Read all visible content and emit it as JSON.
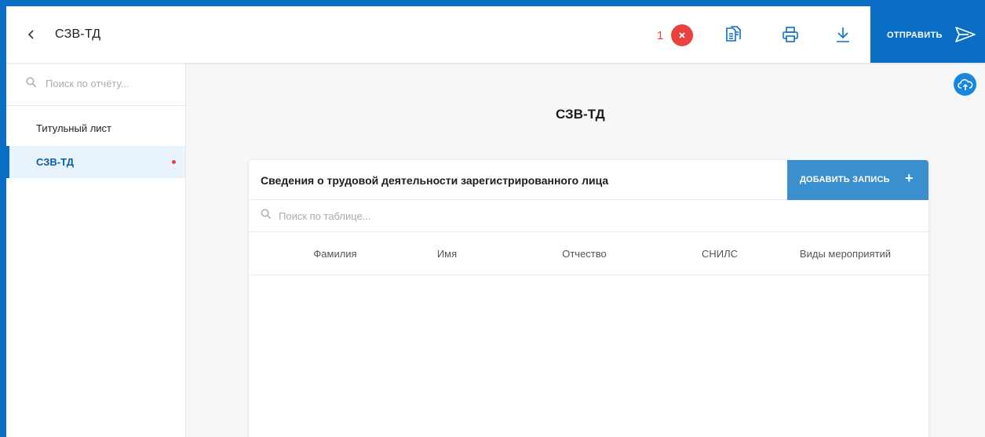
{
  "header": {
    "title": "СЗВ-ТД",
    "error_count": "1",
    "send_label": "ОТПРАВИТЬ"
  },
  "sidebar": {
    "search_placeholder": "Поиск по отчёту...",
    "items": [
      {
        "label": "Титульный лист",
        "active": false,
        "has_error": false
      },
      {
        "label": "СЗВ-ТД",
        "active": true,
        "has_error": true
      }
    ]
  },
  "main": {
    "title": "СЗВ-ТД",
    "card": {
      "title": "Сведения о трудовой деятельности зарегистрированного лица",
      "add_label": "ДОБАВИТЬ ЗАПИСЬ",
      "add_icon": "+",
      "search_placeholder": "Поиск по таблице...",
      "columns": [
        "Фамилия",
        "Имя",
        "Отчество",
        "СНИЛС",
        "Виды мероприятий"
      ]
    }
  },
  "colors": {
    "accent": "#0a6fc4",
    "add_button": "#3b8fcc",
    "error": "#e8413f"
  },
  "icons": [
    "chevron-left-icon",
    "close-icon",
    "copy-document-icon",
    "print-icon",
    "download-icon",
    "send-icon",
    "search-icon",
    "cloud-upload-icon"
  ]
}
